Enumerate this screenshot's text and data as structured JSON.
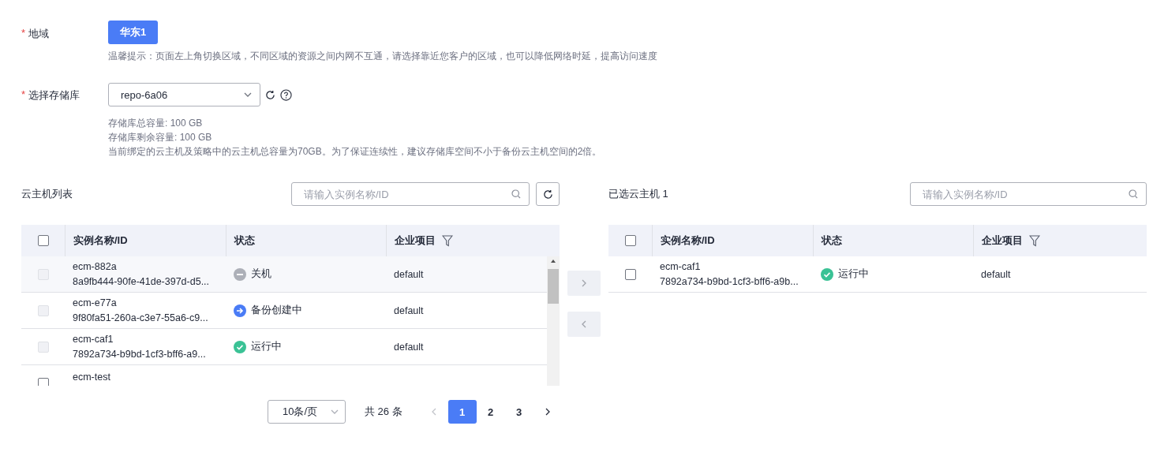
{
  "region": {
    "label": "地域",
    "required_mark": "*",
    "button": "华东1",
    "hint": "温馨提示：页面左上角切换区域，不同区域的资源之间内网不互通，请选择靠近您客户的区域，也可以降低网络时延，提高访问速度"
  },
  "repository": {
    "label": "选择存储库",
    "required_mark": "*",
    "value": "repo-6a06",
    "info": [
      "存储库总容量: 100 GB",
      "存储库剩余容量: 100 GB",
      "当前绑定的云主机及策略中的云主机总容量为70GB。为了保证连续性，建议存储库空间不小于备份云主机空间的2倍。"
    ]
  },
  "left_panel": {
    "title": "云主机列表",
    "search_placeholder": "请输入实例名称/ID",
    "select_all": {
      "checked": false
    },
    "columns": [
      "实例名称/ID",
      "状态",
      "企业项目"
    ],
    "rows": [
      {
        "name": "ecm-882a",
        "id": "8a9fb444-90fe-41de-397d-d5...",
        "status": {
          "kind": "stopped",
          "label": "关机"
        },
        "project": "default",
        "checked": false,
        "disabled": true
      },
      {
        "name": "ecm-e77a",
        "id": "9f80fa51-260a-c3e7-55a6-c9...",
        "status": {
          "kind": "creating",
          "label": "备份创建中"
        },
        "project": "default",
        "checked": false,
        "disabled": true
      },
      {
        "name": "ecm-caf1",
        "id": "7892a734-b9bd-1cf3-bff6-a9...",
        "status": {
          "kind": "running",
          "label": "运行中"
        },
        "project": "default",
        "checked": false,
        "disabled": true
      },
      {
        "name": "ecm-test",
        "checked": false,
        "disabled": false
      }
    ]
  },
  "right_panel": {
    "title": "已选云主机 1",
    "search_placeholder": "请输入实例名称/ID",
    "select_all": {
      "checked": false
    },
    "columns": [
      "实例名称/ID",
      "状态",
      "企业项目"
    ],
    "rows": [
      {
        "name": "ecm-caf1",
        "id": "7892a734-b9bd-1cf3-bff6-a9b...",
        "status": {
          "kind": "running",
          "label": "运行中"
        },
        "project": "default",
        "checked": false,
        "disabled": false
      }
    ]
  },
  "pagination": {
    "page_size": "10条/页",
    "total": "共 26 条",
    "pages": [
      {
        "label": "1",
        "selected": true
      },
      {
        "label": "2",
        "selected": false
      },
      {
        "label": "3",
        "selected": false
      }
    ]
  }
}
